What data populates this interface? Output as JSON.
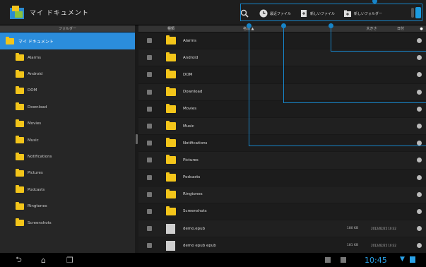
{
  "header": {
    "title": "マイ ドキュメント",
    "actions": [
      {
        "label": "",
        "icon": "search-icon"
      },
      {
        "label": "最近ファイル",
        "icon": "recent-icon"
      },
      {
        "label": "新しいファイル",
        "icon": "new-file-icon"
      },
      {
        "label": "新しいフォルダー",
        "icon": "new-folder-icon"
      }
    ]
  },
  "left_pane": {
    "header": "フォルダー",
    "root": "マイ ドキュメント",
    "items": [
      "Alarms",
      "Android",
      "DOM",
      "Download",
      "Movies",
      "Music",
      "Notifications",
      "Pictures",
      "Podcasts",
      "Ringtones",
      "Screenshots"
    ]
  },
  "right_pane": {
    "columns": {
      "type": "種類",
      "name": "名前 ▲",
      "size": "大きさ",
      "date": "日付"
    },
    "rows": [
      {
        "name": "Alarms",
        "kind": "folder",
        "size": "",
        "date": ""
      },
      {
        "name": "Android",
        "kind": "folder",
        "size": "",
        "date": ""
      },
      {
        "name": "DOM",
        "kind": "folder",
        "size": "",
        "date": ""
      },
      {
        "name": "Download",
        "kind": "folder",
        "size": "",
        "date": ""
      },
      {
        "name": "Movies",
        "kind": "folder",
        "size": "",
        "date": ""
      },
      {
        "name": "Music",
        "kind": "folder",
        "size": "",
        "date": ""
      },
      {
        "name": "Notifications",
        "kind": "folder",
        "size": "",
        "date": ""
      },
      {
        "name": "Pictures",
        "kind": "folder",
        "size": "",
        "date": ""
      },
      {
        "name": "Podcasts",
        "kind": "folder",
        "size": "",
        "date": ""
      },
      {
        "name": "Ringtones",
        "kind": "folder",
        "size": "",
        "date": ""
      },
      {
        "name": "Screenshots",
        "kind": "folder",
        "size": "",
        "date": ""
      },
      {
        "name": "demo.epub",
        "kind": "file",
        "size": "180 KB",
        "date": "2012/02/25 10:32"
      },
      {
        "name": "demo epub epub",
        "kind": "file",
        "size": "181 KB",
        "date": "2012/02/25 10:32"
      }
    ]
  },
  "statusbar": {
    "time": "10:45"
  },
  "colors": {
    "accent": "#2b8ddc",
    "callout": "#1784c8",
    "folder": "#f3c51a"
  }
}
